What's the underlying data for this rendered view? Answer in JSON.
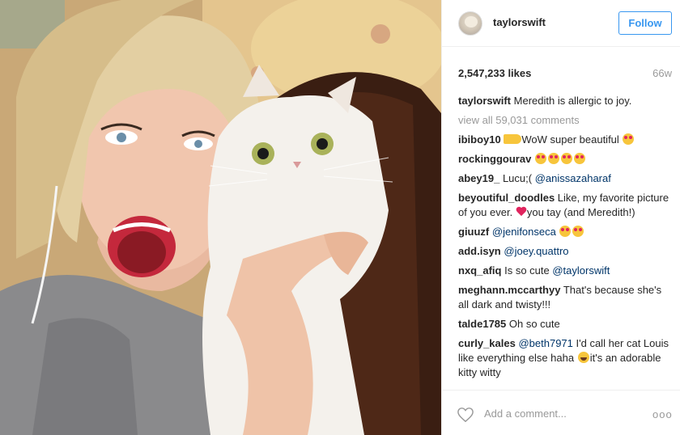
{
  "post": {
    "username": "taylorswift",
    "follow_label": "Follow",
    "likes": "2,547,233 likes",
    "age": "66w",
    "caption_user": "taylorswift",
    "caption_text": "Meredith is allergic to joy.",
    "view_all": "view all 59,031 comments"
  },
  "comments": [
    {
      "user": "ibiboy10",
      "pre": "",
      "text": "WoW super beautiful"
    },
    {
      "user": "rockinggourav",
      "text": ""
    },
    {
      "user": "abey19_",
      "text": "Lucu;(",
      "mention": "@anissazaharaf"
    },
    {
      "user": "beyoutiful_doodles",
      "text": "Like, my favorite picture of you ever.",
      "text2": "you tay (and Meredith!)"
    },
    {
      "user": "giuuzf",
      "mention": "@jenifonseca"
    },
    {
      "user": "add.isyn",
      "mention": "@joey.quattro"
    },
    {
      "user": "nxq_afiq",
      "text": "Is so cute",
      "mention": "@taylorswift"
    },
    {
      "user": "meghann.mccarthyy",
      "text": "That's because she's all dark and twisty!!!"
    },
    {
      "user": "talde1785",
      "text": "Oh so cute"
    },
    {
      "user": "curly_kales",
      "mention": "@beth7971",
      "text": "I'd call her cat Louis like everything else haha",
      "text2": "it's an adorable kitty witty"
    }
  ],
  "footer": {
    "add_comment_placeholder": "Add a comment...",
    "more_label": "ooo"
  },
  "icons": {
    "like": "heart-outline-icon",
    "more": "ellipsis-icon"
  },
  "colors": {
    "follow_blue": "#3897f0",
    "mention": "#003569",
    "muted": "#999999"
  }
}
